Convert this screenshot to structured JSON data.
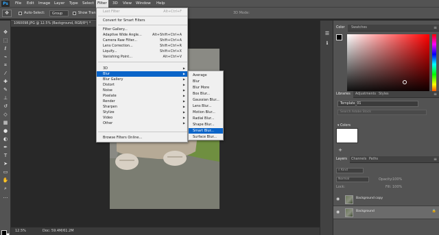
{
  "menubar": {
    "logo": "Ps",
    "items": [
      {
        "label": "File"
      },
      {
        "label": "Edit"
      },
      {
        "label": "Image"
      },
      {
        "label": "Layer"
      },
      {
        "label": "Type"
      },
      {
        "label": "Select"
      },
      {
        "label": "Filter"
      },
      {
        "label": "3D"
      },
      {
        "label": "View"
      },
      {
        "label": "Window"
      },
      {
        "label": "Help"
      }
    ],
    "active": "Filter"
  },
  "options_bar": {
    "auto_select_label": "Auto-Select:",
    "auto_select_value": "Group",
    "show_transform_label": "Show Transf",
    "mode_label": "3D Mode:"
  },
  "document": {
    "tab_title": "1060098.JPG @ 12.5% (Background, RGB/8*) *",
    "zoom": "12.5%",
    "doc_size": "Doc: 59.4M/61.2M"
  },
  "filter_menu": {
    "items": [
      {
        "label": "Last Filter",
        "shortcut": "Alt+Ctrl+F",
        "disabled": true
      },
      {
        "label": "Convert for Smart Filters",
        "shortcut": ""
      },
      {
        "label": "Filter Gallery...",
        "shortcut": ""
      },
      {
        "label": "Adaptive Wide Angle...",
        "shortcut": "Alt+Shift+Ctrl+A"
      },
      {
        "label": "Camera Raw Filter...",
        "shortcut": "Shift+Ctrl+A"
      },
      {
        "label": "Lens Correction...",
        "shortcut": "Shift+Ctrl+R"
      },
      {
        "label": "Liquify...",
        "shortcut": "Shift+Ctrl+X"
      },
      {
        "label": "Vanishing Point...",
        "shortcut": "Alt+Ctrl+V"
      },
      {
        "label": "3D",
        "submenu": true
      },
      {
        "label": "Blur",
        "submenu": true,
        "highlight": true
      },
      {
        "label": "Blur Gallery",
        "submenu": true
      },
      {
        "label": "Distort",
        "submenu": true
      },
      {
        "label": "Noise",
        "submenu": true
      },
      {
        "label": "Pixelate",
        "submenu": true
      },
      {
        "label": "Render",
        "submenu": true
      },
      {
        "label": "Sharpen",
        "submenu": true
      },
      {
        "label": "Stylize",
        "submenu": true
      },
      {
        "label": "Video",
        "submenu": true
      },
      {
        "label": "Other",
        "submenu": true
      },
      {
        "label": "Browse Filters Online...",
        "shortcut": ""
      }
    ]
  },
  "blur_submenu": {
    "items": [
      {
        "label": "Average"
      },
      {
        "label": "Blur"
      },
      {
        "label": "Blur More"
      },
      {
        "label": "Box Blur..."
      },
      {
        "label": "Gaussian Blur..."
      },
      {
        "label": "Lens Blur..."
      },
      {
        "label": "Motion Blur..."
      },
      {
        "label": "Radial Blur..."
      },
      {
        "label": "Shape Blur..."
      },
      {
        "label": "Smart Blur...",
        "highlight": true
      },
      {
        "label": "Surface Blur..."
      }
    ]
  },
  "color_panel": {
    "tabs": [
      {
        "label": "Color",
        "active": true
      },
      {
        "label": "Swatches"
      }
    ],
    "hue_color": "#ff0000"
  },
  "libraries_panel": {
    "tabs": [
      {
        "label": "Libraries",
        "active": true
      },
      {
        "label": "Adjustments"
      },
      {
        "label": "Styles"
      }
    ],
    "library_name": "Template_01",
    "search_placeholder": "Search Adobe Stock",
    "colors_section": "Colors"
  },
  "layers_panel": {
    "tabs": [
      {
        "label": "Layers",
        "active": true
      },
      {
        "label": "Channels"
      },
      {
        "label": "Paths"
      }
    ],
    "kind_filter": "Kind",
    "blend_mode": "Normal",
    "opacity_label": "Opacity:",
    "opacity_value": "100%",
    "lock_label": "Lock:",
    "fill_label": "Fill:",
    "fill_value": "100%",
    "layers": [
      {
        "name": "Background copy",
        "selected": false
      },
      {
        "name": "Background",
        "selected": true
      }
    ]
  },
  "colors": {
    "highlight": "#0a64c8",
    "menu_bg": "#f0f0f0",
    "ui_dark": "#535353"
  }
}
